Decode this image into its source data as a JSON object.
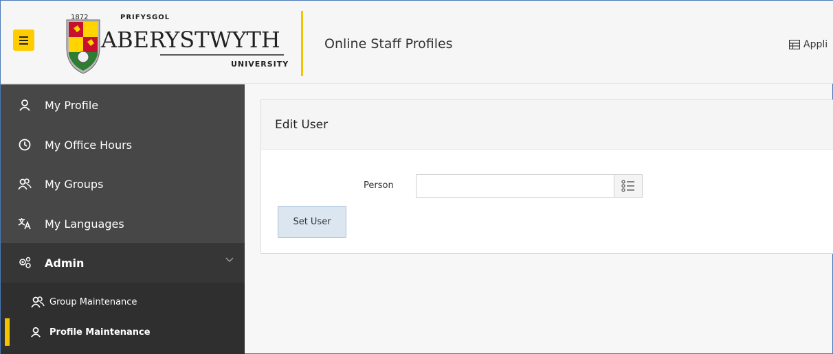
{
  "header": {
    "menu_icon": "hamburger-menu-icon",
    "logo": {
      "year": "1872",
      "welsh_name": "PRIFYSGOL",
      "name": "ABERYSTWYTH",
      "subtitle": "UNIVERSITY"
    },
    "app_title": "Online Staff Profiles",
    "app_link": "Appli",
    "accent_color": "#ffcc00"
  },
  "sidebar": {
    "items": [
      {
        "label": "My Profile",
        "icon": "user-icon"
      },
      {
        "label": "My Office Hours",
        "icon": "clock-icon"
      },
      {
        "label": "My Groups",
        "icon": "users-icon"
      },
      {
        "label": "My Languages",
        "icon": "translate-icon"
      },
      {
        "label": "Admin",
        "icon": "gears-icon"
      }
    ],
    "subitems": [
      {
        "label": "Group Maintenance",
        "icon": "users-icon"
      },
      {
        "label": "Profile Maintenance",
        "icon": "user-icon",
        "active": true
      }
    ]
  },
  "main": {
    "card_title": "Edit User",
    "person_label": "Person",
    "person_value": "",
    "set_user_label": "Set User"
  }
}
